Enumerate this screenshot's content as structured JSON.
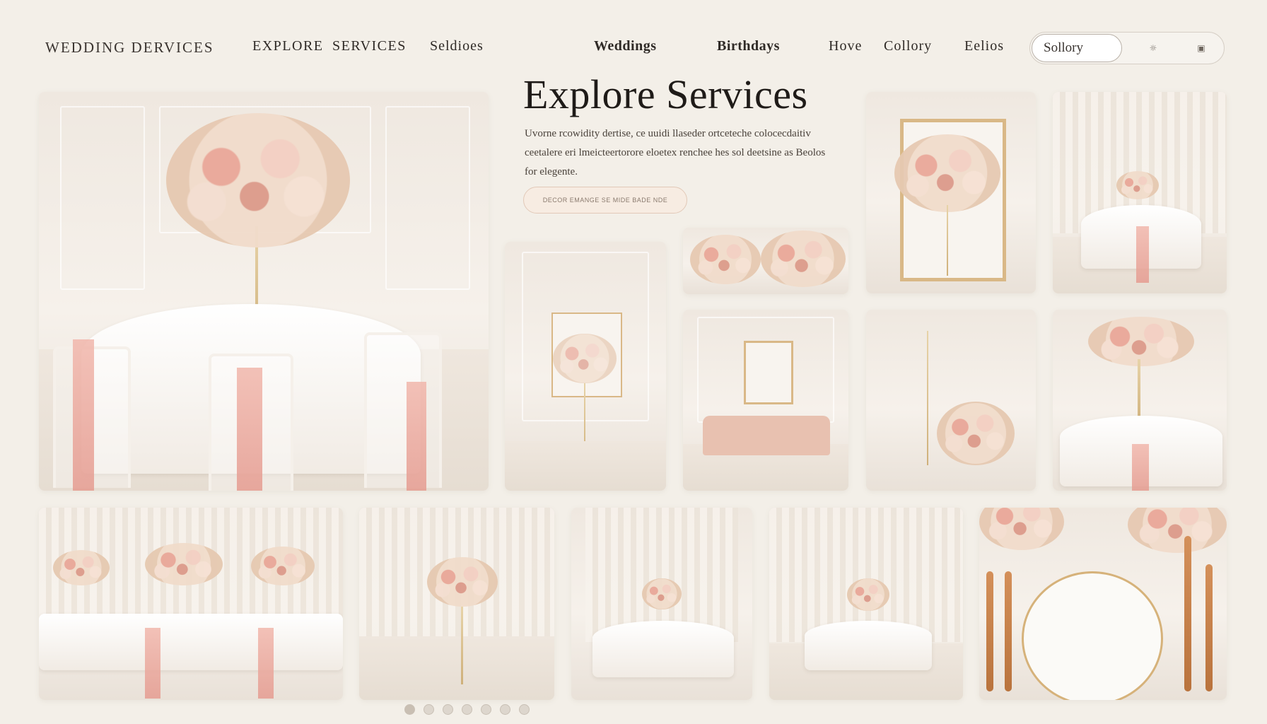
{
  "header": {
    "brand": "WEDDING DERVICES",
    "nav": [
      {
        "label": "EXPLORE"
      },
      {
        "label": "SERVICES"
      },
      {
        "label": "Seldioes"
      },
      {
        "label": "Weddings"
      },
      {
        "label": "Birthdays"
      },
      {
        "label": "Hove"
      },
      {
        "label": "Collory"
      },
      {
        "label": "Eelios"
      }
    ],
    "search": {
      "value": "Sollory",
      "ctrl1_icon": "sun-icon",
      "ctrl2_icon": "square-icon"
    }
  },
  "hero": {
    "title": "Explore Services",
    "description": "Uvorne rcowidity dertise, ce uuidi llaseder ortceteche colocecdaitiv ceetalere eri lmeicteertorore eloetex renchee hes sol deetsine as Beolos for elegente.",
    "cta_label": "DECOR EMANGE SE MIDE BADE NDE"
  },
  "gallery": {
    "tiles": [
      {
        "name": "banquet-hall-photo",
        "icon": "image-icon"
      },
      {
        "name": "floral-frame-photo",
        "icon": "image-icon"
      },
      {
        "name": "draped-tables-photo",
        "icon": "image-icon"
      },
      {
        "name": "wall-arrangement-photo",
        "icon": "image-icon"
      },
      {
        "name": "roses-garland-photo",
        "icon": "image-icon"
      },
      {
        "name": "lounge-sofa-photo",
        "icon": "image-icon"
      },
      {
        "name": "vase-roses-photo",
        "icon": "image-icon"
      },
      {
        "name": "crystal-centerpiece-photo",
        "icon": "image-icon"
      },
      {
        "name": "long-tables-photo",
        "icon": "image-icon"
      },
      {
        "name": "pedestal-arrangement-photo",
        "icon": "image-icon"
      },
      {
        "name": "reception-room-photo",
        "icon": "image-icon"
      },
      {
        "name": "curtain-hall-photo",
        "icon": "image-icon"
      },
      {
        "name": "place-setting-photo",
        "icon": "image-icon"
      }
    ]
  },
  "pagination": {
    "count": 7,
    "active_index": 0
  },
  "colors": {
    "background": "#f3efe8",
    "accent_blush": "#e9a798",
    "accent_gold": "#d6b27a"
  }
}
